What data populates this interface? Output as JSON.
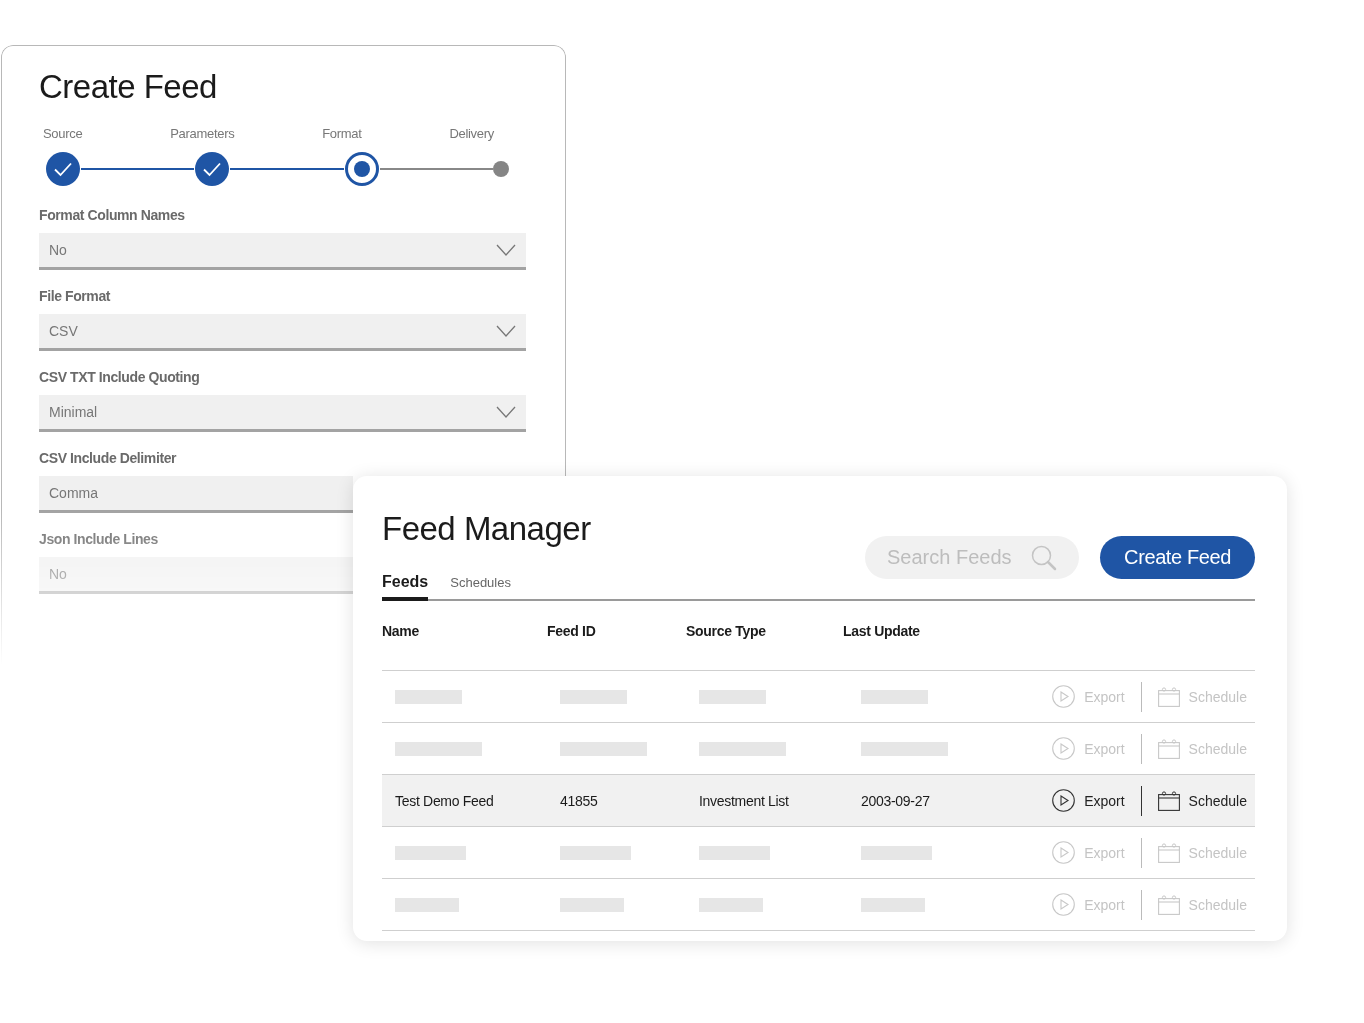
{
  "create_feed": {
    "title": "Create Feed",
    "steps": [
      {
        "label": "Source",
        "completed": true,
        "current": false
      },
      {
        "label": "Parameters",
        "completed": true,
        "current": false
      },
      {
        "label": "Format",
        "completed": false,
        "current": true
      },
      {
        "label": "Delivery",
        "completed": false,
        "current": false
      }
    ],
    "fields": [
      {
        "label": "Format Column Names",
        "value": "No",
        "kind": "select"
      },
      {
        "label": "File Format",
        "value": "CSV",
        "kind": "select"
      },
      {
        "label": "CSV TXT Include Quoting",
        "value": "Minimal",
        "kind": "select"
      },
      {
        "label": "CSV Include Delimiter",
        "value": "Comma",
        "kind": "select"
      },
      {
        "label": "Json Include Lines",
        "value": "No",
        "kind": "select"
      }
    ]
  },
  "feed_manager": {
    "title": "Feed Manager",
    "search": {
      "placeholder": "Search Feeds"
    },
    "create_button": "Create Feed",
    "tabs": [
      {
        "label": "Feeds",
        "selected": true
      },
      {
        "label": "Schedules",
        "selected": false
      }
    ],
    "table": {
      "columns": [
        "Name",
        "Feed ID",
        "Source Type",
        "Last Update"
      ],
      "rows": [
        {
          "kind": "skeleton",
          "selected": false,
          "actions": [
            {
              "label": "Export",
              "disabled": true
            },
            {
              "label": "Schedule",
              "disabled": true
            }
          ]
        },
        {
          "kind": "skeleton",
          "selected": false,
          "actions": [
            {
              "label": "Export",
              "disabled": true
            },
            {
              "label": "Schedule",
              "disabled": true
            }
          ]
        },
        {
          "kind": "data",
          "selected": true,
          "cells": [
            "Test Demo Feed",
            "41855",
            "Investment List",
            "2003-09-27"
          ],
          "actions": [
            {
              "label": "Export",
              "disabled": false
            },
            {
              "label": "Schedule",
              "disabled": false
            }
          ]
        },
        {
          "kind": "skeleton",
          "selected": false,
          "actions": [
            {
              "label": "Export",
              "disabled": true
            },
            {
              "label": "Schedule",
              "disabled": true
            }
          ]
        },
        {
          "kind": "skeleton",
          "selected": false,
          "actions": [
            {
              "label": "Export",
              "disabled": true
            },
            {
              "label": "Schedule",
              "disabled": true
            }
          ]
        }
      ]
    }
  }
}
